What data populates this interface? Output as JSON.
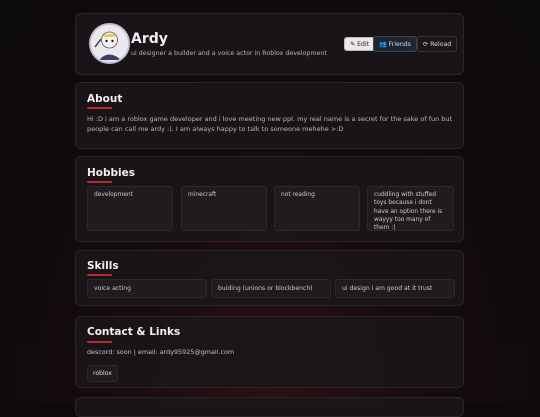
{
  "profile": {
    "name": "Ardy",
    "bio": "ui designer a builder and a voice actor in Roblox development",
    "avatar": "avatar"
  },
  "actions": {
    "edit_icon": "pencil-icon",
    "edit_label": "✎ Edit",
    "friends_icon": "friends-icon",
    "friends_label": "👥 Friends",
    "reload_icon": "reload-icon",
    "reload_label": "⟳ Reload"
  },
  "about": {
    "title": "About",
    "text": "Hi :D i am a roblox game developer and i love meeting new ppl. my real name is a secret for the sake of fun but people can call me ardy :). I am always happy to talk to someone mehehe >:D"
  },
  "hobbies": {
    "title": "Hobbies",
    "items": [
      "development",
      "minecraft",
      "not reading",
      "cuddling with stuffed toys because i dont have an option there is wayyy too many of them :|"
    ]
  },
  "skills": {
    "title": "Skills",
    "items": [
      "voice acting",
      "buiding (unions or blockbench)",
      "ui design i am good at it trust"
    ]
  },
  "contact": {
    "title": "Contact & Links",
    "text": "descord: soon | email: ardy95925@gmail.com",
    "links": [
      "roblox"
    ]
  },
  "colors": {
    "accent": "#c1272f",
    "background": "#120b0d",
    "card": "#1a1619"
  }
}
